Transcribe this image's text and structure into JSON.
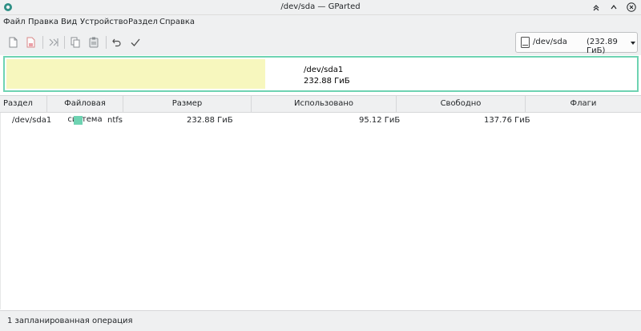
{
  "window": {
    "title": "/dev/sda — GParted"
  },
  "menubar": {
    "items": [
      "Файл",
      "Правка",
      "Вид",
      "Устройство",
      "Раздел",
      "Справка"
    ]
  },
  "toolbar": {
    "buttons": [
      "new-partition-icon",
      "delete-partition-icon",
      "resize-move-icon",
      "copy-icon",
      "paste-icon",
      "undo-icon",
      "apply-icon"
    ]
  },
  "device": {
    "name": "/dev/sda",
    "size": "(232.89 ГиБ)"
  },
  "disk_visual": {
    "partition_name": "/dev/sda1",
    "partition_size": "232.88 ГиБ",
    "used_fraction": 0.409,
    "colors": {
      "border": "#6ed3b2",
      "used": "#f7f7be"
    }
  },
  "table": {
    "columns": [
      "Раздел",
      "Файловая система",
      "Размер",
      "Использовано",
      "Свободно",
      "Флаги"
    ],
    "rows": [
      {
        "partition": "/dev/sda1",
        "filesystem": "ntfs",
        "size": "232.88 ГиБ",
        "used": "95.12 ГиБ",
        "free": "137.76 ГиБ",
        "flags": "",
        "fs_color": "#6ed3b2"
      }
    ]
  },
  "status": {
    "text": "1 запланированная операция"
  }
}
